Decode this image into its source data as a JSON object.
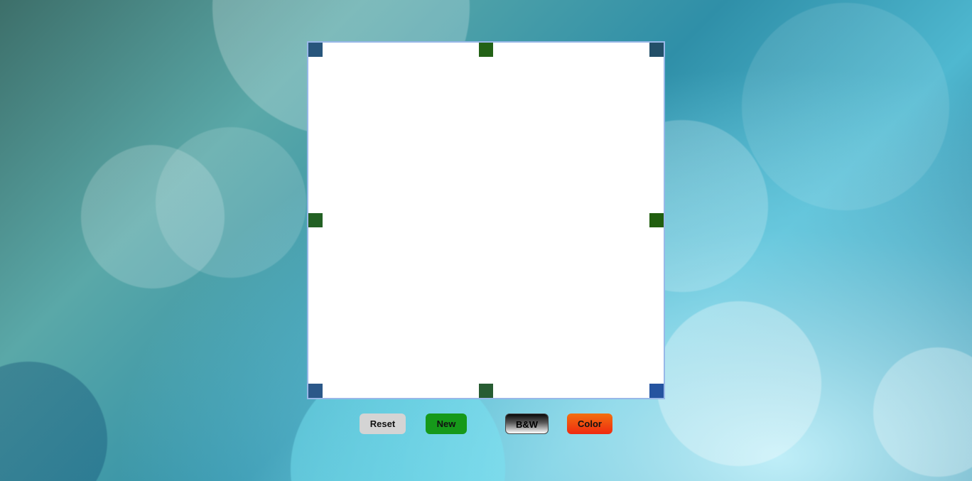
{
  "canvas": {
    "handles": [
      "top-left",
      "top-center",
      "top-right",
      "middle-left",
      "middle-right",
      "bottom-left",
      "bottom-center",
      "bottom-right"
    ]
  },
  "toolbar": {
    "reset_label": "Reset",
    "new_label": "New",
    "bw_label": "B&W",
    "color_label": "Color"
  },
  "colors": {
    "canvas_border": "#98b8e8",
    "new_button": "#16991a",
    "color_button_top": "#f2700f",
    "color_button_bottom": "#ef2a10",
    "reset_button": "#d4d4d4"
  }
}
